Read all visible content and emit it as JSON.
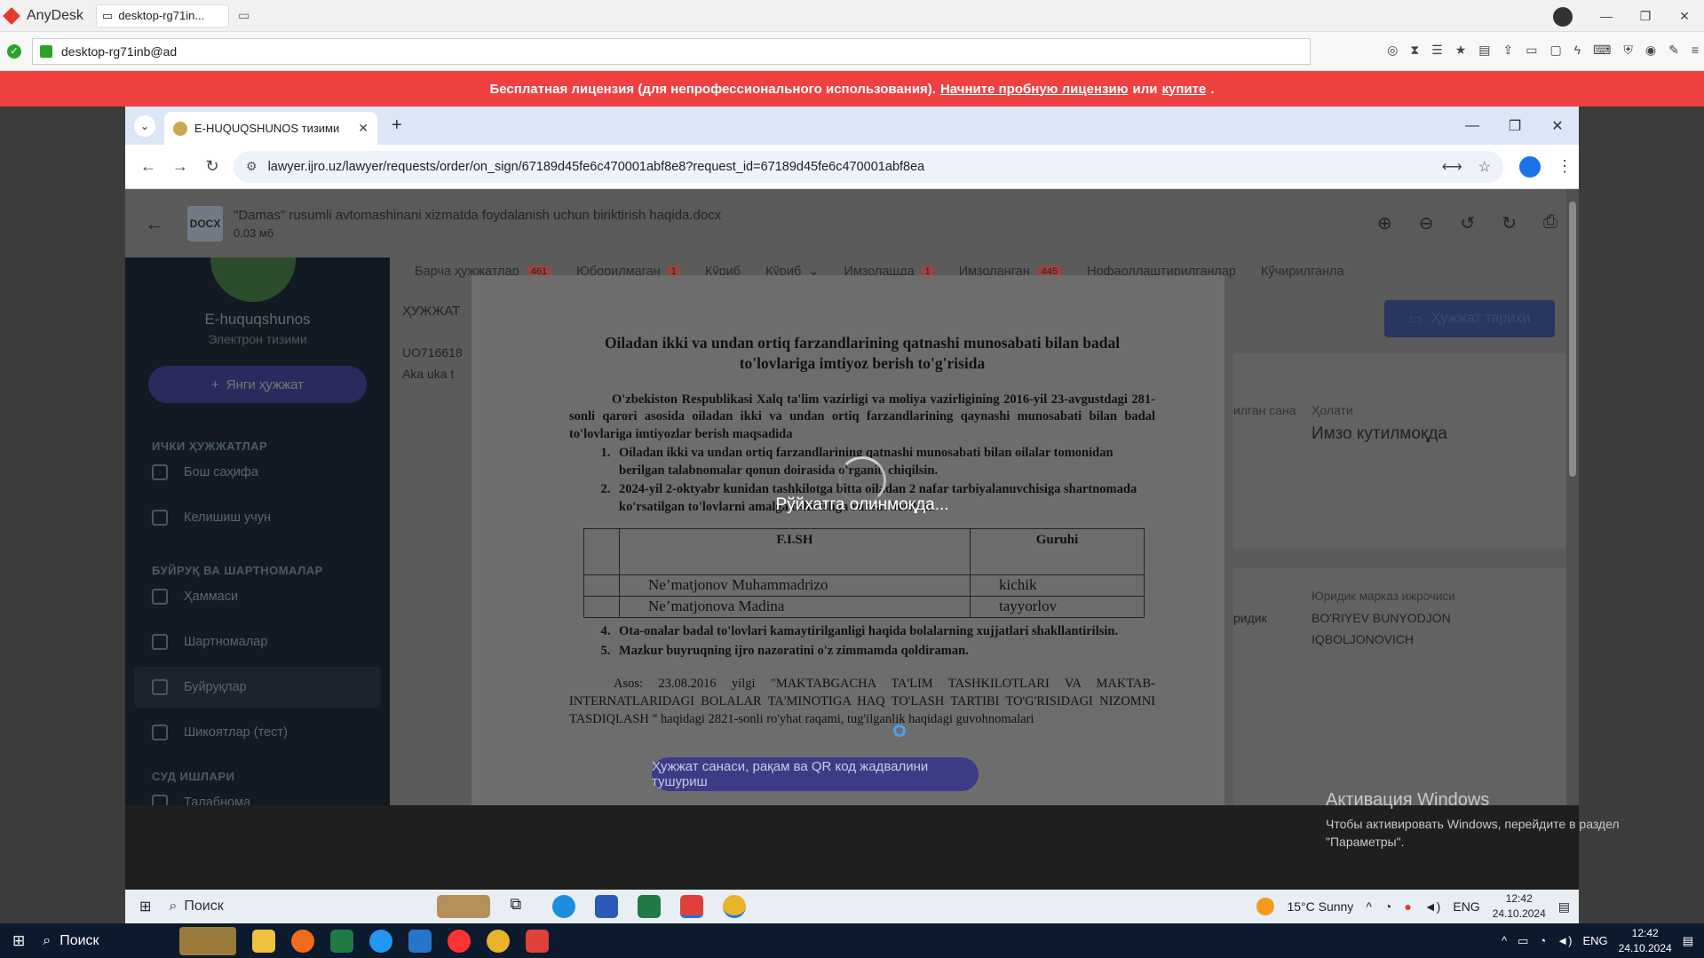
{
  "anydesk": {
    "app_name": "AnyDesk",
    "tab_label": "desktop-rg71in...",
    "address": "desktop-rg71inb@ad",
    "license_text": "Бесплатная лицензия (для непрофессионального использования).",
    "license_trial": "Начните пробную лицензию",
    "license_or": "или",
    "license_buy": "купите",
    "license_end": "."
  },
  "browser": {
    "tab_title": "E-HUQUQSHUNOS тизими",
    "url": "lawyer.ijro.uz/lawyer/requests/order/on_sign/67189d45fe6c470001abf8e8?request_id=67189d45fe6c470001abf8ea"
  },
  "doc_header": {
    "badge": "DOCX",
    "file_name": "\"Damas\" rusumli avtomashinani xizmatda foydalanish uchun biriktirish haqida.docx",
    "file_size": "0.03 мб"
  },
  "sidebar": {
    "brand": "E-huquqshunos",
    "brand_sub": "Электрон тизими",
    "new_doc": "Янги ҳужжат",
    "section1": "ИЧКИ ҲУЖЖАТЛАР",
    "item_home": "Бош саҳифа",
    "item_contract": "Келишиш учун",
    "section2": "БУЙРУҚ ВА ШАРТНОМАЛАР",
    "item_all": "Ҳаммаси",
    "item_contracts": "Шартномалар",
    "item_orders": "Буйруқлар",
    "item_complaints": "Шикоятлар (тест)",
    "section3": "СУД ИШЛАРИ",
    "item_requests": "Талабнома"
  },
  "main": {
    "tab_all": "Барча ҳужжатлар",
    "tab_all_count": "461",
    "tab_unsent": "Юборилмаган",
    "tab_unsent_count": "1",
    "tab_review1": "Кўриб",
    "tab_review2": "Кўриб",
    "tab_signing": "Имзолашда",
    "tab_signing_count": "1",
    "tab_signed": "Имзоланган",
    "tab_signed_count": "445",
    "tab_inactive": "Нофаоллаштирилганлар",
    "tab_deleted": "Кўчирилганла",
    "history_btn": "Ҳужжат тарихи",
    "left_title": "ҲУЖЖАТ",
    "left_code": "UO716618",
    "left_sub": "Aka uka t",
    "date_label": "илган сана",
    "status_label": "Ҳолати",
    "status_value": "Имзо кутилмоқда",
    "exec_label": "Юридик марказ ижрочиси",
    "exec_left": "ридик",
    "exec_name1": "BO'RIYEV BUNYODJON",
    "exec_name2": "IQBOLJONOVICH"
  },
  "preview": {
    "title": "Oiladan ikki va undan ortiq farzandlarining qatnashi munosabati bilan badal to'lovlariga imtiyoz berish to'g'risida",
    "intro": "O'zbekiston Respublikasi Xalq ta'lim vazirligi va moliya vazirligining 2016-yil 23-avgustdagi 281-sonli qarori asosida oiladan ikki va undan ortiq farzandlarining qaynashi munosabati bilan badal to'lovlariga imtiyozlar berish maqsadida",
    "item1": "Oiladan ikki va undan ortiq farzandlarining qatnashi munosabati bilan oilalar tomonidan berilgan talabnomalar qonun doirasida o'rganib chiqilsin.",
    "item2": "2024-yil 2-oktyabr kunidan tashkilotga bitta oiladan 2 nafar tarbiyalanuvchisiga shartnomada ko'rsatilgan to'lovlarni amalga oshirishga ruhsat berilsin.",
    "col_name": "F.I.SH",
    "col_group": "Guruhi",
    "rows": [
      {
        "name": "Ne’matjonov Muhammadrizo",
        "group": "kichik"
      },
      {
        "name": "Ne’matjonova Madina",
        "group": "tayyorlov"
      }
    ],
    "item4": "Ota-onalar badal to'lovlari kamaytirilganligi haqida bolalarning xujjatlari shakllantirilsin.",
    "item5": "Mazkur buyruqning ijro nazoratini o'z zimmamda qoldiraman.",
    "asos": "Asos: 23.08.2016 yilgi \"MAKTABGACHA TA'LIM TASHKILOTLARI VA MAKTAB-INTERNATLARIDAGI BOLALAR TA'MINOTIGA HAQ TO'LASH TARTIBI TO'G'RISIDAGI NIZOMNI TASDIQLASH \" haqidagi 2821-sonli ro'yhat raqami, tug'ilganlik haqidagi guvohnomalari",
    "loading": "Рўйхатга олинмоқда...",
    "qr_button": "Ҳужжат санаси, рақам ва QR код жадвалини тушуриш"
  },
  "activation": {
    "title": "Активация Windows",
    "subtitle": "Чтобы активировать Windows, перейдите в раздел \"Параметры\"."
  },
  "inner_taskbar": {
    "search": "Поиск",
    "weather": "15°C  Sunny",
    "lang": "ENG",
    "time": "12:42",
    "date": "24.10.2024"
  },
  "taskbar": {
    "search": "Поиск",
    "lang": "ENG",
    "time": "12:42",
    "date": "24.10.2024"
  }
}
